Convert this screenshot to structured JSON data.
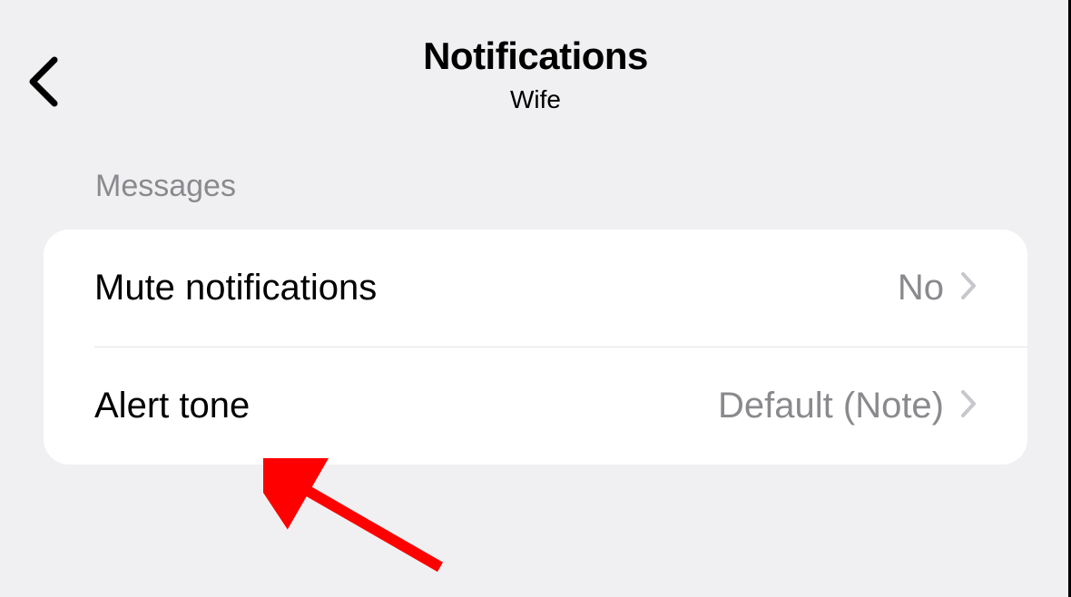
{
  "header": {
    "title": "Notifications",
    "subtitle": "Wife"
  },
  "section": {
    "header": "Messages"
  },
  "rows": [
    {
      "label": "Mute notifications",
      "value": "No"
    },
    {
      "label": "Alert tone",
      "value": "Default (Note)"
    }
  ]
}
